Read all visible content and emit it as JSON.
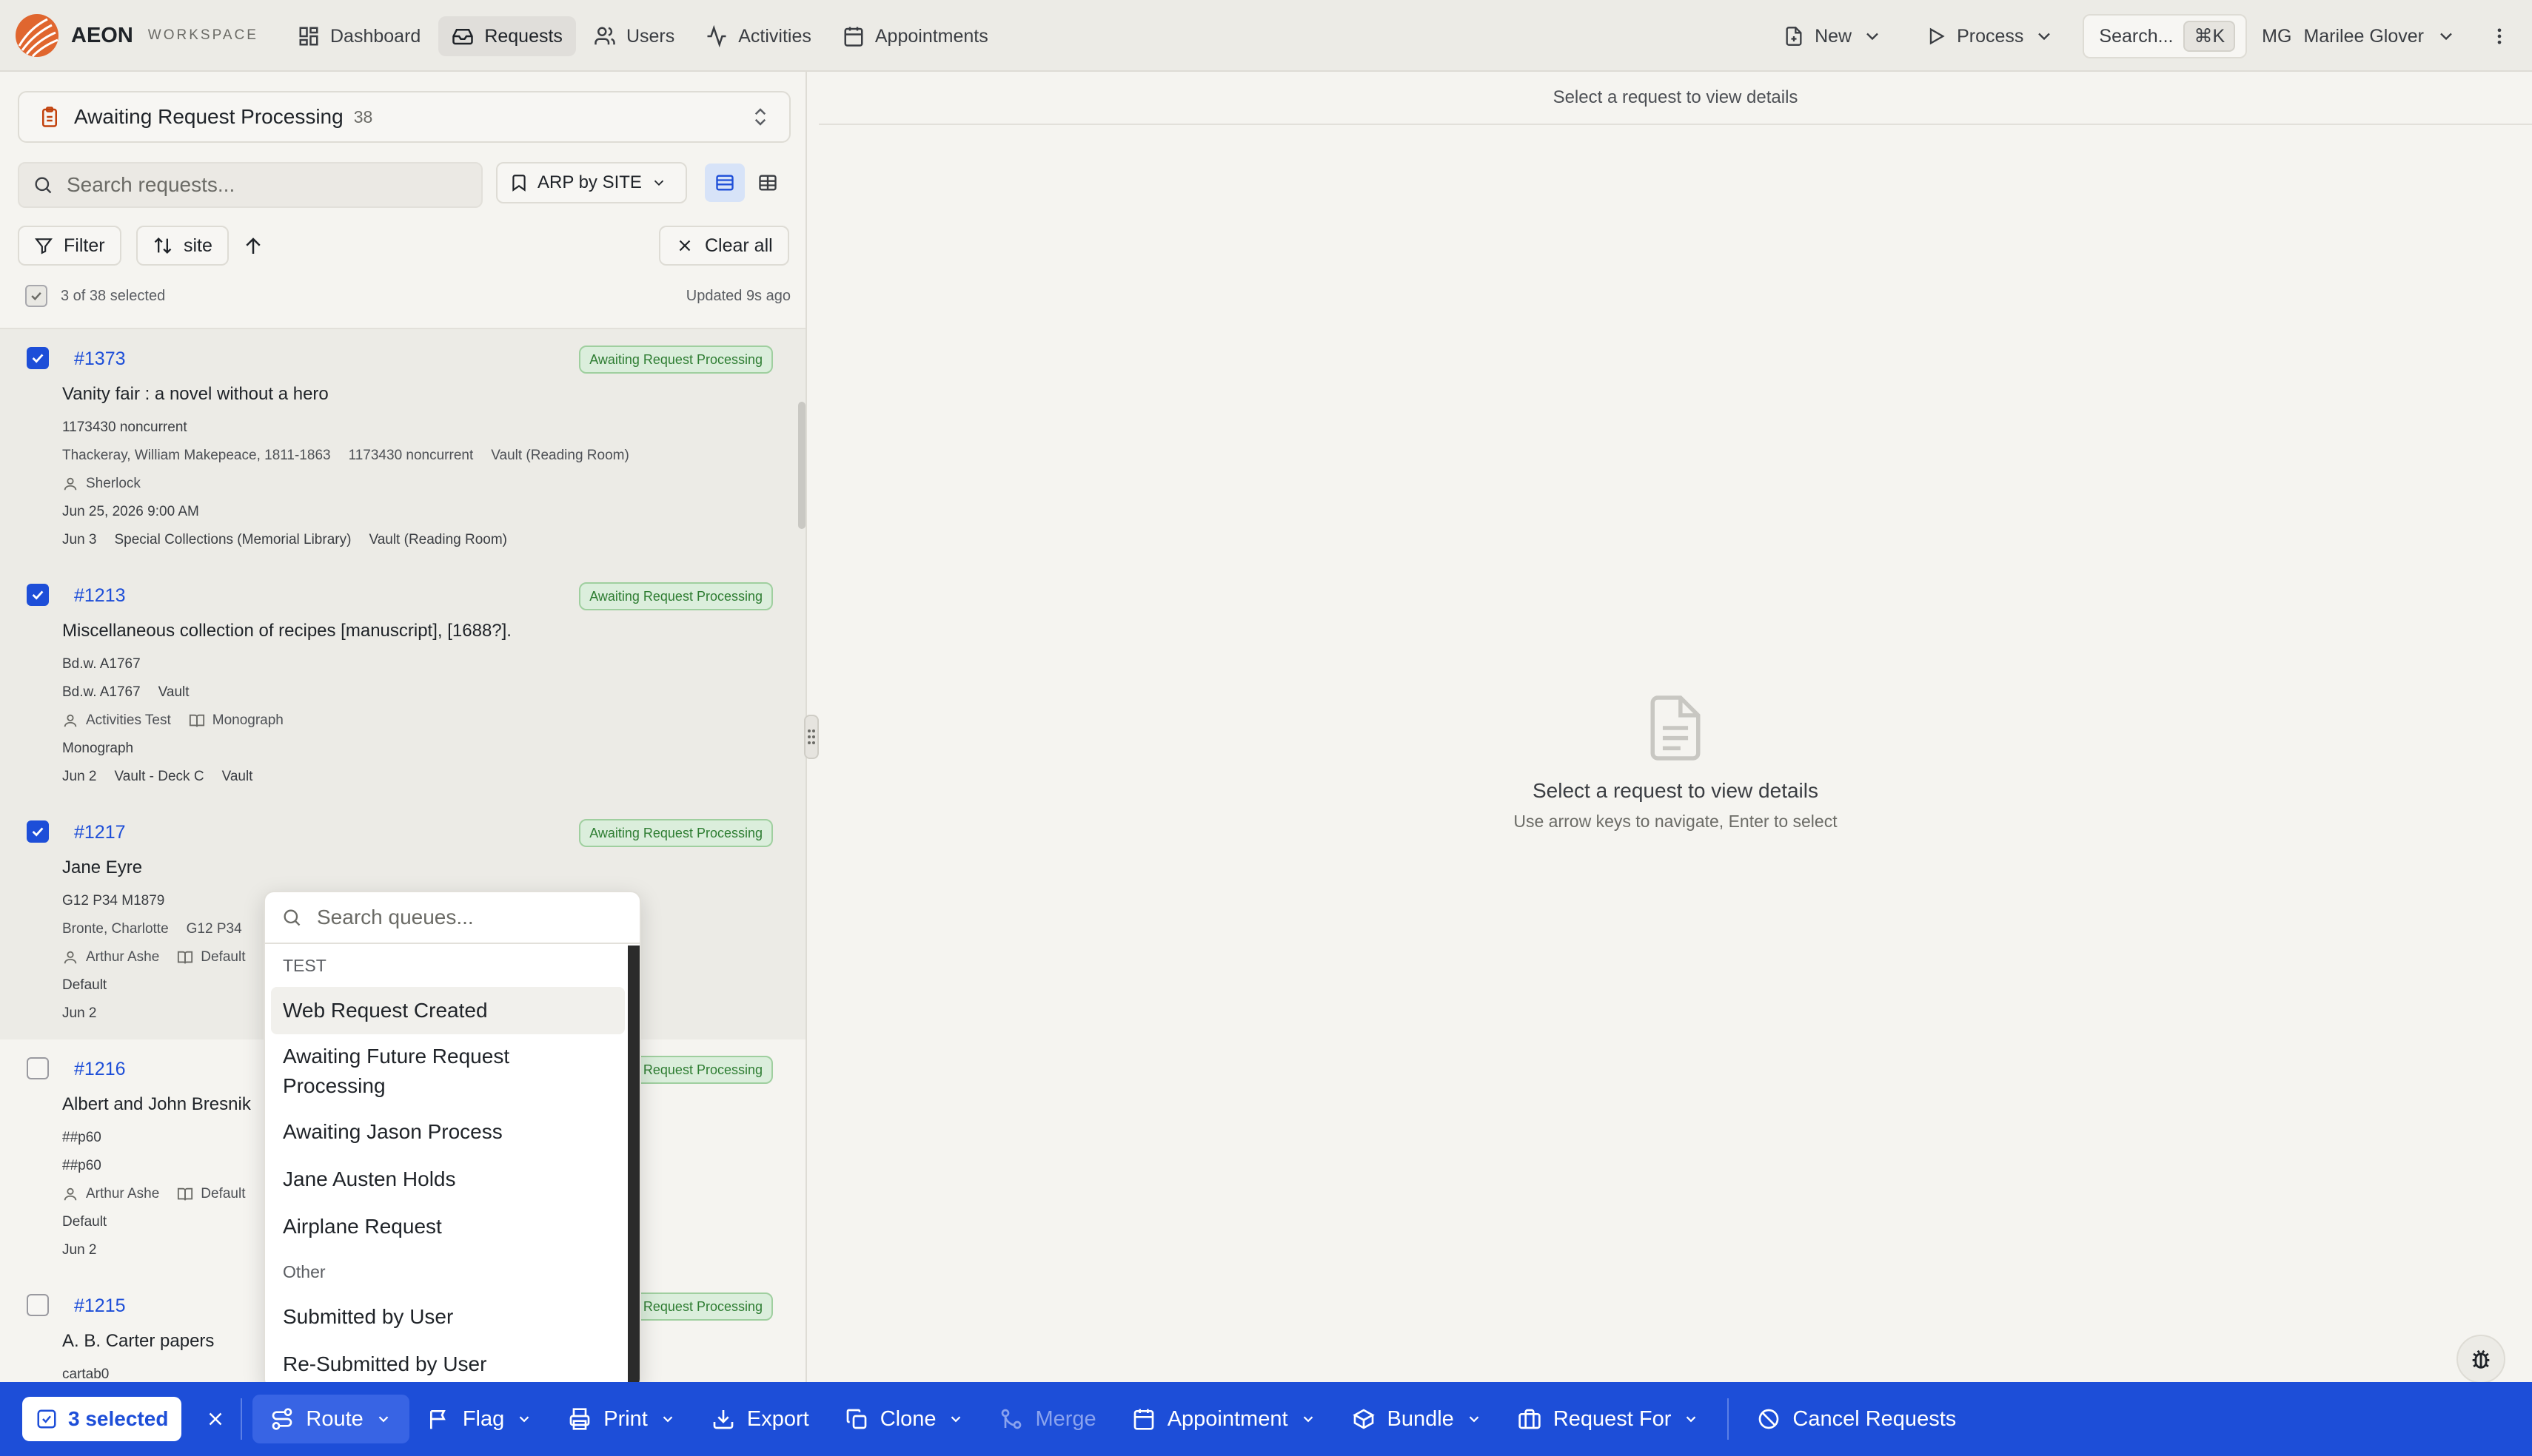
{
  "brand": {
    "name": "AEON",
    "sub": "WORKSPACE"
  },
  "nav": [
    {
      "label": "Dashboard",
      "icon": "dashboard-icon"
    },
    {
      "label": "Requests",
      "icon": "inbox-icon",
      "active": true
    },
    {
      "label": "Users",
      "icon": "users-icon"
    },
    {
      "label": "Activities",
      "icon": "activity-icon"
    },
    {
      "label": "Appointments",
      "icon": "calendar-icon"
    }
  ],
  "topright": {
    "new_label": "New",
    "process_label": "Process",
    "search_label": "Search...",
    "search_kbd": "⌘K",
    "user_initials": "MG",
    "user_name": "Marilee Glover"
  },
  "queue": {
    "name": "Awaiting Request Processing",
    "count": "38"
  },
  "list_controls": {
    "search_placeholder": "Search requests...",
    "saved_view": "ARP by SITE",
    "filter_label": "Filter",
    "sort_label": "site",
    "clear_label": "Clear all",
    "selection_text": "3 of 38 selected",
    "updated_text": "Updated 9s ago"
  },
  "requests": [
    {
      "id": "#1373",
      "status": "Awaiting Request Processing",
      "title": "Vanity fair : a novel without a hero",
      "selected": true,
      "lines": [
        {
          "parts": [
            "1173430 noncurrent"
          ]
        },
        {
          "parts": [
            "Thackeray, William Makepeace, 1811-1863",
            "1173430 noncurrent",
            "Vault (Reading Room)"
          ],
          "muted": true
        },
        {
          "parts": [
            "Sherlock"
          ],
          "icons": [
            "user-icon"
          ],
          "muted": true
        },
        {
          "parts": [
            "Jun 25, 2026 9:00 AM"
          ]
        },
        {
          "parts": [
            "Jun 3",
            "Special Collections (Memorial Library)",
            "Vault (Reading Room)"
          ]
        }
      ]
    },
    {
      "id": "#1213",
      "status": "Awaiting Request Processing",
      "title": "Miscellaneous collection of recipes [manuscript], [1688?].",
      "selected": true,
      "lines": [
        {
          "parts": [
            "Bd.w. A1767"
          ]
        },
        {
          "parts": [
            "Bd.w. A1767",
            "Vault"
          ]
        },
        {
          "parts": [
            "Activities Test",
            "Monograph"
          ],
          "icons": [
            "user-icon",
            "book-icon"
          ],
          "muted": true
        },
        {
          "parts": [
            "Monograph"
          ]
        },
        {
          "parts": [
            "Jun 2",
            "Vault - Deck C",
            "Vault"
          ]
        }
      ]
    },
    {
      "id": "#1217",
      "status": "Awaiting Request Processing",
      "title": "Jane Eyre",
      "selected": true,
      "lines": [
        {
          "parts": [
            "G12 P34 M1879"
          ]
        },
        {
          "parts": [
            "Bronte, Charlotte",
            "G12 P34"
          ],
          "muted": true
        },
        {
          "parts": [
            "Arthur Ashe",
            "Default"
          ],
          "icons": [
            "user-icon",
            "book-icon"
          ],
          "muted": true
        },
        {
          "parts": [
            "Default"
          ]
        },
        {
          "parts": [
            "Jun 2"
          ]
        }
      ]
    },
    {
      "id": "#1216",
      "status": "Awaiting Request Processing",
      "title": "Albert and John Bresnik",
      "selected": false,
      "lines": [
        {
          "parts": [
            "##p60"
          ]
        },
        {
          "parts": [
            "##p60"
          ]
        },
        {
          "parts": [
            "Arthur Ashe",
            "Default"
          ],
          "icons": [
            "user-icon",
            "book-icon"
          ],
          "muted": true
        },
        {
          "parts": [
            "Default"
          ]
        },
        {
          "parts": [
            "Jun 2"
          ]
        }
      ]
    },
    {
      "id": "#1215",
      "status": "Awaiting Request Processing",
      "title": "A. B. Carter papers",
      "selected": false,
      "lines": [
        {
          "parts": [
            "cartab0"
          ]
        }
      ]
    }
  ],
  "detail": {
    "header": "Select a request to view details",
    "empty_title": "Select a request to view details",
    "empty_sub": "Use arrow keys to navigate, Enter to select"
  },
  "queue_menu": {
    "search_placeholder": "Search queues...",
    "sections": [
      {
        "title": "TEST",
        "items": [
          "Web Request Created",
          "Awaiting Future Request Processing",
          "Awaiting Jason Process",
          "Jane Austen Holds",
          "Airplane Request"
        ]
      },
      {
        "title": "Other",
        "items": [
          "Submitted by User",
          "Re-Submitted by User"
        ]
      }
    ]
  },
  "bulk_bar": {
    "selected_label": "3 selected",
    "actions": [
      {
        "label": "Route",
        "icon": "route-icon",
        "chevron": true,
        "active": true
      },
      {
        "label": "Flag",
        "icon": "flag-icon",
        "chevron": true
      },
      {
        "label": "Print",
        "icon": "printer-icon",
        "chevron": true
      },
      {
        "label": "Export",
        "icon": "download-icon",
        "chevron": false
      },
      {
        "label": "Clone",
        "icon": "copy-icon",
        "chevron": true
      },
      {
        "label": "Merge",
        "icon": "merge-icon",
        "chevron": false,
        "disabled": true
      },
      {
        "label": "Appointment",
        "icon": "calendar-icon",
        "chevron": true
      },
      {
        "label": "Bundle",
        "icon": "package-icon",
        "chevron": true
      },
      {
        "label": "Request For",
        "icon": "briefcase-icon",
        "chevron": true
      },
      {
        "label": "Cancel Requests",
        "icon": "ban-icon",
        "chevron": false
      }
    ]
  },
  "colors": {
    "accent": "#1d4ed8",
    "badge_bg": "#dbeedc",
    "badge_text": "#2e7d32",
    "brand_orange": "#e0662f"
  }
}
